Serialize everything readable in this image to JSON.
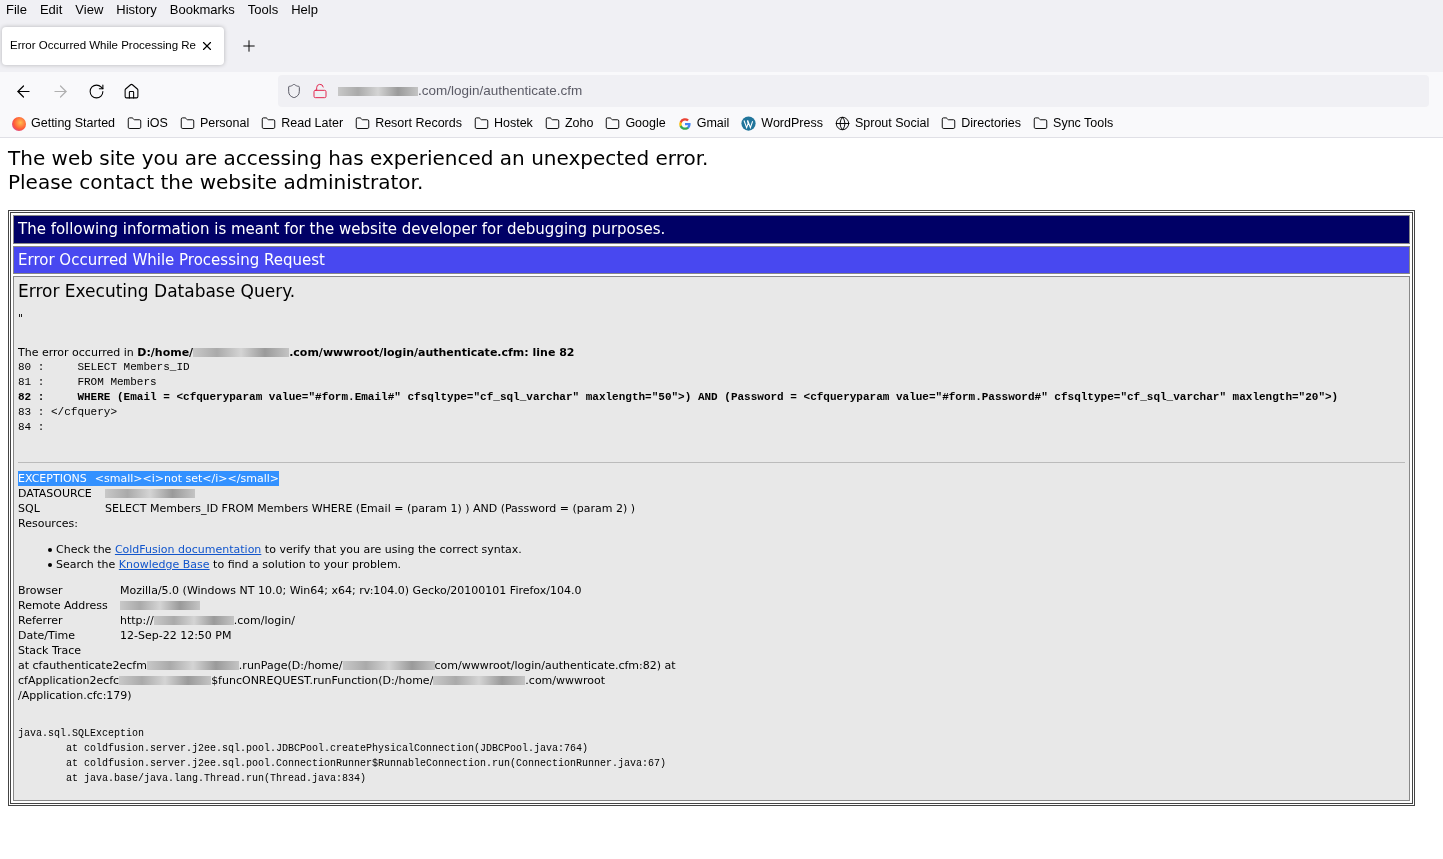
{
  "menu_bar": [
    "File",
    "Edit",
    "View",
    "History",
    "Bookmarks",
    "Tools",
    "Help"
  ],
  "tab": {
    "title": "Error Occurred While Processing Re",
    "selected": true
  },
  "address_bar": {
    "url": [
      {
        "kind": "redacted"
      },
      {
        "kind": "text",
        "text": ".com/login/authenticate.cfm"
      }
    ]
  },
  "bookmarks": [
    {
      "label": "Getting Started",
      "kind": "firefox"
    },
    {
      "label": "iOS",
      "kind": "folder"
    },
    {
      "label": "Personal",
      "kind": "folder"
    },
    {
      "label": "Read Later",
      "kind": "folder"
    },
    {
      "label": "Resort Records",
      "kind": "folder"
    },
    {
      "label": "Hostek",
      "kind": "folder"
    },
    {
      "label": "Zoho",
      "kind": "folder"
    },
    {
      "label": "Google",
      "kind": "folder"
    },
    {
      "label": "Gmail",
      "kind": "google"
    },
    {
      "label": "WordPress",
      "kind": "wordpress"
    },
    {
      "label": "Sprout Social",
      "kind": "globe"
    },
    {
      "label": "Directories",
      "kind": "folder"
    },
    {
      "label": "Sync Tools",
      "kind": "folder"
    }
  ],
  "page": {
    "heading_lines": [
      "The web site you are accessing has experienced an unexpected error.",
      "Please contact the website administrator."
    ],
    "debug": {
      "notice": "The following information is meant for the website developer for debugging purposes.",
      "error_title": "Error Occurred While Processing Request",
      "query_title": "Error Executing Database Query.",
      "quote": "\"",
      "location": [
        {
          "kind": "text",
          "text": "The error occurred in **D:/home/**"
        },
        {
          "kind": "redacted"
        },
        {
          "kind": "text",
          "text": "**.com/wwwroot/login/authenticate.cfm: line 82**"
        }
      ],
      "code_lines": [
        {
          "text": "80 :     SELECT Members_ID",
          "bold": false
        },
        {
          "text": "81 :     FROM Members",
          "bold": false
        },
        {
          "text": "82 :     WHERE (Email = <cfqueryparam value=\"#form.Email#\" cfsqltype=\"cf_sql_varchar\" maxlength=\"50\">) AND (Password = <cfqueryparam value=\"#form.Password#\" cfsqltype=\"cf_sql_varchar\" maxlength=\"20\">)",
          "bold": true
        },
        {
          "text": "83 : </cfquery>",
          "bold": false
        },
        {
          "text": "84 :",
          "bold": false
        }
      ],
      "exceptions": {
        "label": "EXCEPTIONS",
        "value": "<small><i>not set</i></small>",
        "highlighted": true
      },
      "fields": [
        {
          "label": "DATASOURCE",
          "value": [
            {
              "kind": "redacted"
            }
          ]
        },
        {
          "label": "SQL",
          "value": [
            {
              "kind": "text",
              "text": "SELECT Members_ID FROM Members WHERE (Email = (param 1) ) AND (Password = (param 2) )"
            }
          ]
        },
        {
          "label": "Resources:"
        }
      ],
      "resources": [
        {
          "before": "Check the",
          "link": "ColdFusion documentation",
          "after": "to verify that you are using the correct syntax."
        },
        {
          "before": "Search the",
          "link": "Knowledge Base",
          "after": "to find a solution to your problem."
        }
      ],
      "info": [
        {
          "label": "Browser",
          "value": [
            {
              "kind": "text",
              "text": "Mozilla/5.0 (Windows NT 10.0; Win64; x64; rv:104.0) Gecko/20100101 Firefox/104.0"
            }
          ]
        },
        {
          "label": "Remote Address",
          "value": [
            {
              "kind": "redacted"
            }
          ]
        },
        {
          "label": "Referrer",
          "value": [
            {
              "kind": "text",
              "text": "http://"
            },
            {
              "kind": "redacted"
            },
            {
              "kind": "text",
              "text": ".com/login/"
            }
          ]
        },
        {
          "label": "Date/Time",
          "value": [
            {
              "kind": "text",
              "text": "12-Sep-22 12:50 PM"
            }
          ]
        },
        {
          "label": "Stack Trace"
        }
      ],
      "stack_trace": [
        [
          {
            "kind": "text",
            "text": "at cfauthenticate2ecfm"
          },
          {
            "kind": "redacted"
          },
          {
            "kind": "text",
            "text": ".runPage(D:/home/"
          },
          {
            "kind": "redacted"
          },
          {
            "kind": "text",
            "text": "com/wwwroot/login/authenticate.cfm:82) at"
          }
        ],
        [
          {
            "kind": "text",
            "text": "cfApplication2ecfc"
          },
          {
            "kind": "redacted"
          },
          {
            "kind": "text",
            "text": "$funcONREQUEST.runFunction(D:/home/"
          },
          {
            "kind": "redacted"
          },
          {
            "kind": "text",
            "text": ".com/wwwroot"
          }
        ],
        [
          {
            "kind": "text",
            "text": "/Application.cfc:179)"
          }
        ]
      ],
      "java_trace": [
        "java.sql.SQLException",
        "        at coldfusion.server.j2ee.sql.pool.JDBCPool.createPhysicalConnection(JDBCPool.java:764)",
        "        at coldfusion.server.j2ee.sql.pool.ConnectionRunner$RunnableConnection.run(ConnectionRunner.java:67)",
        "        at java.base/java.lang.Thread.run(Thread.java:834)"
      ]
    }
  }
}
